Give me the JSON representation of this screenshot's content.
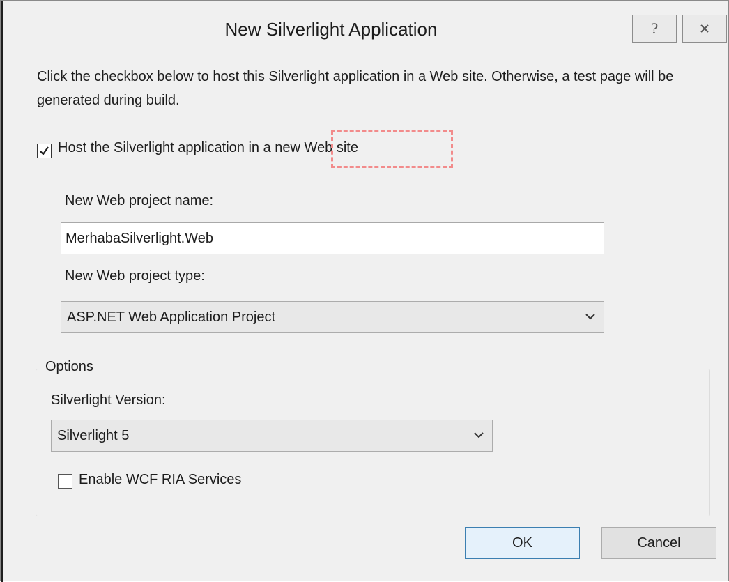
{
  "window": {
    "title": "New Silverlight Application"
  },
  "caption_buttons": {
    "help_glyph": "?",
    "help_icon": "help-icon",
    "close_icon": "close-icon"
  },
  "instructions": "Click the checkbox below to host this Silverlight application in a Web site. Otherwise, a test page will be generated during build.",
  "host": {
    "label": "Host the Silverlight application in a new Web site",
    "checked": true
  },
  "web_project": {
    "name_label": "New Web project name:",
    "name_value": "MerhabaSilverlight.Web",
    "type_label": "New Web project type:",
    "type_value": "ASP.NET Web Application Project"
  },
  "options": {
    "legend": "Options",
    "version_label": "Silverlight Version:",
    "version_value": "Silverlight 5",
    "wcf_label": "Enable WCF RIA Services",
    "wcf_checked": false
  },
  "buttons": {
    "ok": "OK",
    "cancel": "Cancel"
  },
  "colors": {
    "focus_rect": "#f28b8b",
    "ok_border": "#3c7fb1",
    "dialog_bg": "#f0f0f0"
  }
}
